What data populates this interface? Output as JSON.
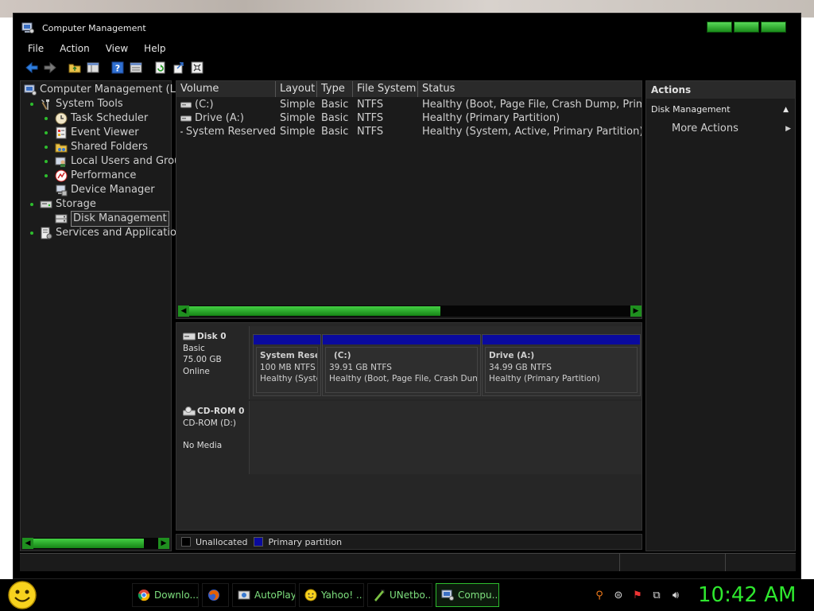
{
  "window": {
    "title": "Computer Management",
    "menu": [
      "File",
      "Action",
      "View",
      "Help"
    ]
  },
  "toolbar": {
    "icons": [
      "back-icon",
      "forward-icon",
      "up-folder-icon",
      "show-hide-tree-icon",
      "help-icon",
      "properties-icon",
      "refresh-icon",
      "export-list-icon",
      "console-view-icon"
    ]
  },
  "tree": {
    "root": "Computer Management (Loc",
    "system_tools": "System Tools",
    "task_scheduler": "Task Scheduler",
    "event_viewer": "Event Viewer",
    "shared_folders": "Shared Folders",
    "local_users": "Local Users and Grou",
    "performance": "Performance",
    "device_manager": "Device Manager",
    "storage": "Storage",
    "disk_management": "Disk Management",
    "services": "Services and Applications"
  },
  "volumes": {
    "columns": [
      "Volume",
      "Layout",
      "Type",
      "File System",
      "Status"
    ],
    "rows": [
      {
        "volume": "(C:)",
        "layout": "Simple",
        "type": "Basic",
        "fs": "NTFS",
        "status": "Healthy (Boot, Page File, Crash Dump, Primary"
      },
      {
        "volume": "Drive (A:)",
        "layout": "Simple",
        "type": "Basic",
        "fs": "NTFS",
        "status": "Healthy (Primary Partition)"
      },
      {
        "volume": "System Reserved",
        "layout": "Simple",
        "type": "Basic",
        "fs": "NTFS",
        "status": "Healthy (System, Active, Primary Partition)"
      }
    ]
  },
  "disks": {
    "disk0": {
      "name": "Disk 0",
      "type": "Basic",
      "size": "75.00 GB",
      "state": "Online",
      "partitions": [
        {
          "name": "System Rese",
          "size": "100 MB NTFS",
          "status": "Healthy (Syste"
        },
        {
          "name": "(C:)",
          "size": "39.91 GB NTFS",
          "status": "Healthy (Boot, Page File, Crash Dump,"
        },
        {
          "name": "Drive  (A:)",
          "size": "34.99 GB NTFS",
          "status": "Healthy (Primary Partition)"
        }
      ]
    },
    "cdrom0": {
      "name": "CD-ROM 0",
      "drive": "CD-ROM (D:)",
      "media": "No Media"
    }
  },
  "legend": {
    "unallocated": "Unallocated",
    "primary": "Primary partition",
    "unallocated_color": "#000000",
    "primary_color": "#0a0a9e"
  },
  "actions": {
    "header": "Actions",
    "section": "Disk Management",
    "more": "More Actions"
  },
  "taskbar": {
    "items": [
      "Downlo...",
      "",
      "AutoPlay",
      "Yahoo! ...",
      "UNetbo...",
      "Compu..."
    ],
    "clock": "10:42 AM",
    "accent": "#2ee82e"
  }
}
